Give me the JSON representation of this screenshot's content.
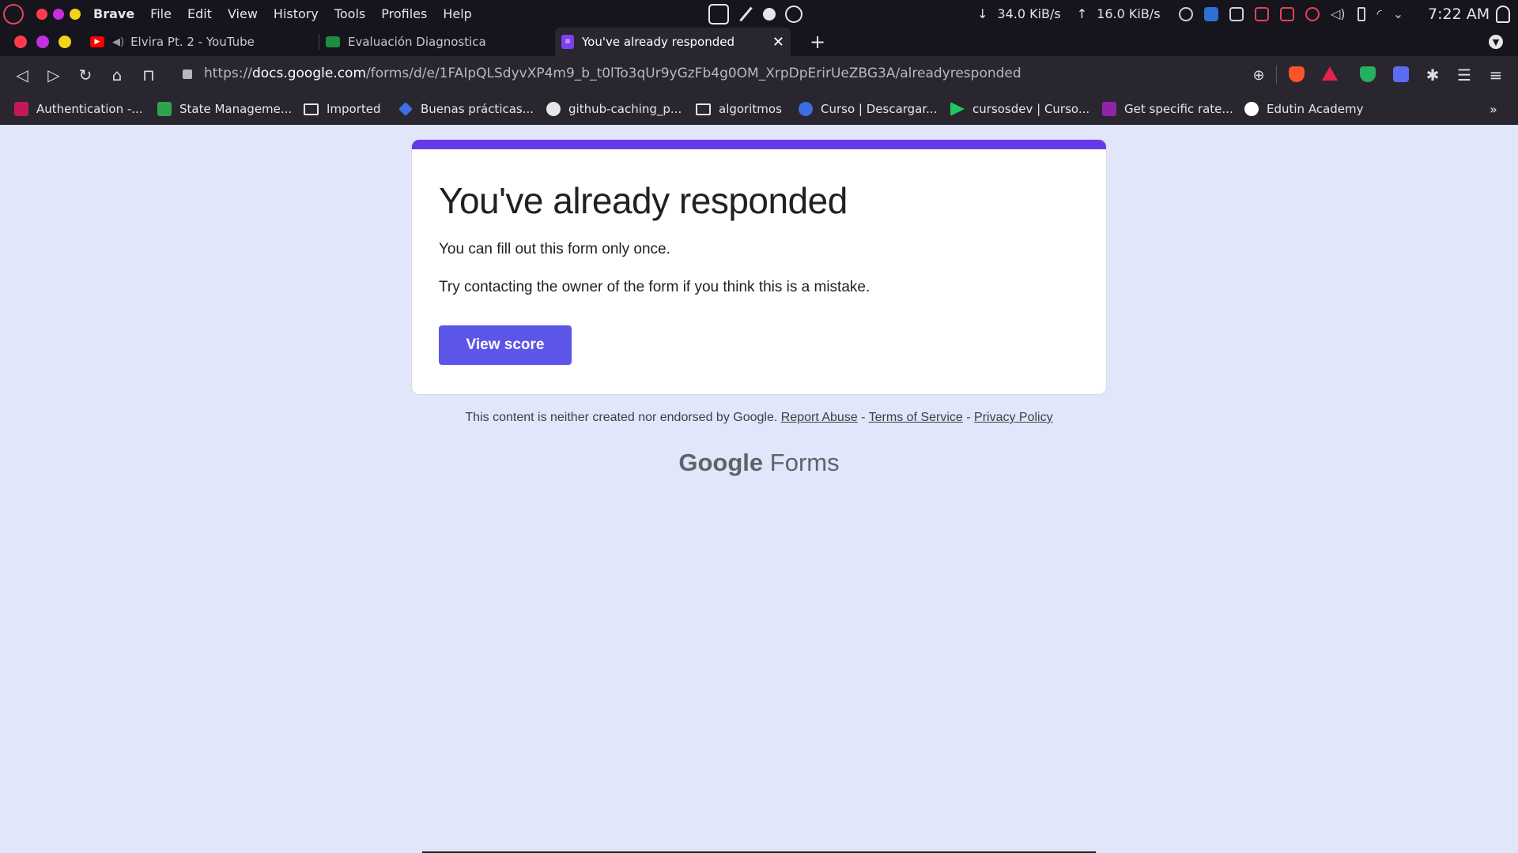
{
  "system_bar": {
    "app_name": "Brave",
    "menu": [
      "File",
      "Edit",
      "View",
      "History",
      "Tools",
      "Profiles",
      "Help"
    ],
    "download_speed": "34.0 KiB/s",
    "upload_speed": "16.0 KiB/s",
    "clock": "7:22 AM"
  },
  "tabs": [
    {
      "label": "Elvira Pt. 2 - YouTube",
      "icon": "youtube-icon",
      "active": false
    },
    {
      "label": "Evaluación Diagnostica",
      "icon": "google-classroom-icon",
      "active": false
    },
    {
      "label": "You've already responded",
      "icon": "google-forms-icon",
      "active": true
    }
  ],
  "address_bar": {
    "url_prefix": "https://",
    "url_host": "docs.google.com",
    "url_path": "/forms/d/e/1FAIpQLSdyvXP4m9_b_t0lTo3qUr9yGzFb4g0OM_XrpDpErirUeZBG3A/alreadyresponded"
  },
  "bookmarks": [
    {
      "label": "Authentication -...",
      "icon": "bookmark-favicon-icon"
    },
    {
      "label": "State Manageme...",
      "icon": "bookmark-favicon-icon"
    },
    {
      "label": "Imported",
      "icon": "folder-icon"
    },
    {
      "label": "Buenas prácticas...",
      "icon": "bookmark-favicon-icon"
    },
    {
      "label": "github-caching_p...",
      "icon": "globe-icon"
    },
    {
      "label": "algoritmos",
      "icon": "folder-icon"
    },
    {
      "label": "Curso | Descargar...",
      "icon": "bookmark-favicon-icon"
    },
    {
      "label": "cursosdev | Curso...",
      "icon": "bookmark-favicon-icon"
    },
    {
      "label": "Get specific rate...",
      "icon": "bookmark-favicon-icon"
    },
    {
      "label": "Edutin Academy",
      "icon": "bookmark-favicon-icon"
    }
  ],
  "page": {
    "title": "You've already responded",
    "line1": "You can fill out this form only once.",
    "line2": "Try contacting the owner of the form if you think this is a mistake.",
    "button_label": "View score",
    "accent_color": "#673ae9",
    "button_color": "#5b55e8",
    "background_color": "#e1e6fa"
  },
  "footer": {
    "disclaimer": "This content is neither created nor endorsed by Google.",
    "link_report": "Report Abuse",
    "link_terms": "Terms of Service",
    "link_privacy": "Privacy Policy",
    "separator": " - ",
    "brand_google": "Google",
    "brand_forms": "Forms"
  }
}
